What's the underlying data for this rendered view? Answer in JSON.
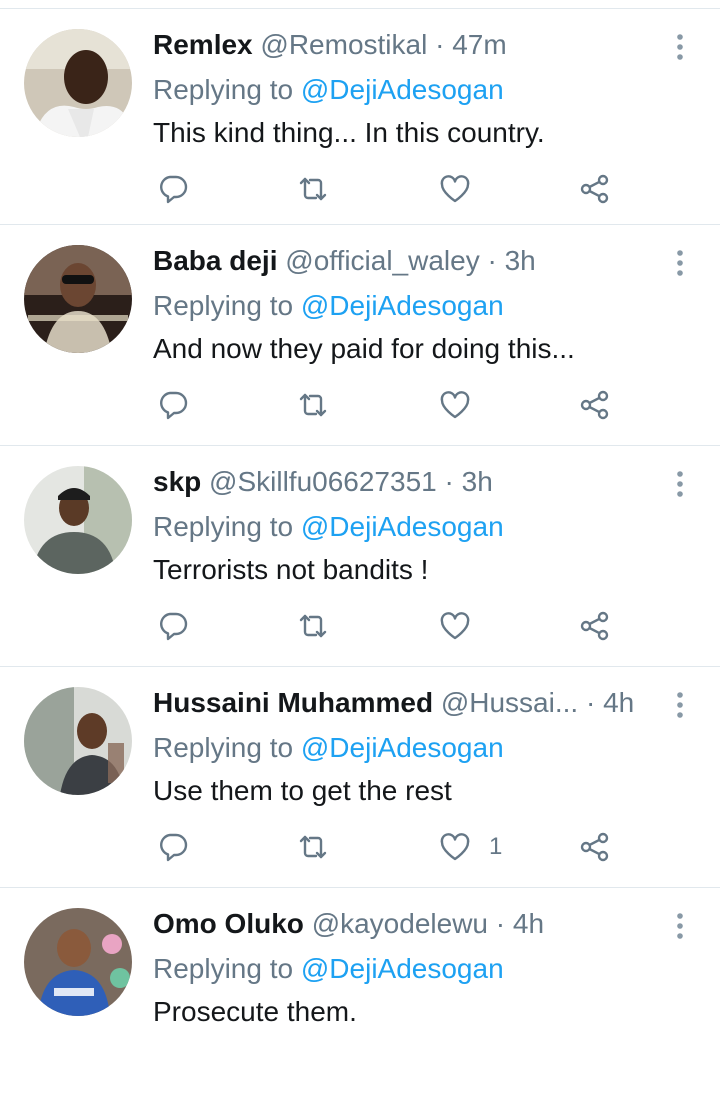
{
  "tweets": [
    {
      "name": "Remlex",
      "handle": "@Remostikal",
      "dot": "·",
      "time": "47m",
      "replying_prefix": "Replying to ",
      "replying_to": "@DejiAdesogan",
      "text": "This kind thing... In this country.",
      "likes": ""
    },
    {
      "name": "Baba deji",
      "handle": "@official_waley",
      "dot": "·",
      "time": "3h",
      "replying_prefix": "Replying to ",
      "replying_to": "@DejiAdesogan",
      "text": "And now they paid for doing this...",
      "likes": ""
    },
    {
      "name": "skp",
      "handle": "@Skillfu06627351",
      "dot": "·",
      "time": "3h",
      "replying_prefix": "Replying to ",
      "replying_to": "@DejiAdesogan",
      "text": "Terrorists not bandits !",
      "likes": ""
    },
    {
      "name": "Hussaini Muhammed",
      "handle": "@Hussai...",
      "dot": "·",
      "time": "4h",
      "replying_prefix": "Replying to ",
      "replying_to": "@DejiAdesogan",
      "text": "Use them to get the rest",
      "likes": "1"
    },
    {
      "name": "Omo Oluko",
      "handle": "@kayodelewu",
      "dot": "·",
      "time": "4h",
      "replying_prefix": "Replying to ",
      "replying_to": "@DejiAdesogan",
      "text": "Prosecute them.",
      "likes": ""
    }
  ],
  "icons": {
    "reply": "reply-icon",
    "retweet": "retweet-icon",
    "like": "heart-icon",
    "share": "share-icon",
    "more": "more-vertical-icon"
  },
  "colors": {
    "link": "#1da1f2",
    "secondary_text": "#657786",
    "primary_text": "#14171a",
    "divider": "#e1e8ed"
  }
}
